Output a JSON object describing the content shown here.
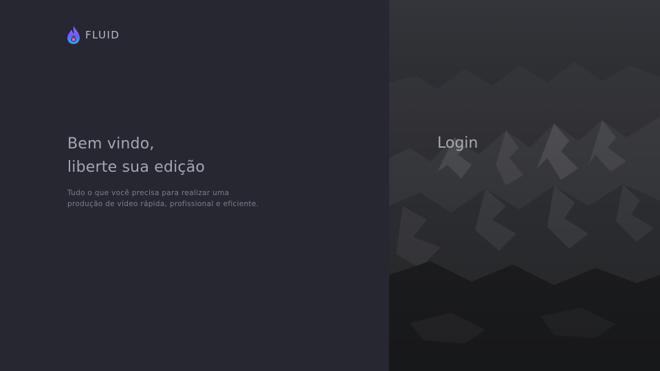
{
  "brand": {
    "name": "FLUID",
    "logo_icon": "fluid-drop-icon",
    "colors": {
      "gradient_top": "#7b5cff",
      "gradient_bottom": "#1fb6ff",
      "text": "#b6b8c4"
    }
  },
  "hero": {
    "title_line1": "Bem vindo,",
    "title_line2": "liberte sua edição",
    "subtitle": "Tudo o que você precisa para realizar uma produção de vídeo rápida, profissional e eficiente."
  },
  "login_panel": {
    "title": "Login",
    "background": "snowy-mountain-photo"
  },
  "colors": {
    "left_panel_bg": "#262731",
    "heading_text": "#a5a6b1",
    "body_text": "#7d7f8a"
  }
}
